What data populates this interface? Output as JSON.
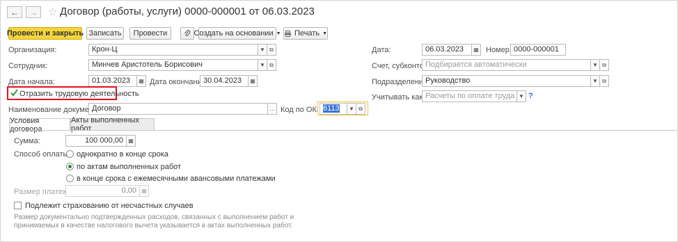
{
  "header": {
    "title": "Договор (работы, услуги) 0000-000001 от 06.03.2023"
  },
  "toolbar": {
    "post_close": "Провести и закрыть",
    "save": "Записать",
    "post": "Провести",
    "create_based": "Создать на основании",
    "print": "Печать"
  },
  "form": {
    "org_label": "Организация:",
    "org_value": "Крон-Ц",
    "employee_label": "Сотрудник:",
    "employee_value": "Минчев Аристотель Борисович",
    "start_label": "Дата начала:",
    "start_value": "01.03.2023",
    "end_label": "Дата окончания:",
    "end_value": "30.04.2023",
    "labor_checkbox_label": "Отразить трудовую деятельность",
    "labor_checked": true,
    "docname_label": "Наименование документа:",
    "docname_value": "Договор",
    "okz_label": "Код по ОКЗ:",
    "okz_value": "6113",
    "date_label": "Дата:",
    "date_value": "06.03.2023",
    "number_label": "Номер:",
    "number_value": "0000-000001",
    "account_label": "Счет, субконто:",
    "account_placeholder": "Подбирается автоматически",
    "department_label": "Подразделение:",
    "department_value": "Руководство",
    "account_as_label": "Учитывать как:",
    "account_as_placeholder": "Расчеты по оплате труда",
    "help": "?"
  },
  "tabs": [
    {
      "label": "Условия договора"
    },
    {
      "label": "Акты выполненных работ"
    }
  ],
  "terms": {
    "sum_label": "Сумма:",
    "sum_value": "100 000,00",
    "payment_label": "Способ оплаты:",
    "payment_options": [
      {
        "label": "однократно в конце срока",
        "selected": false
      },
      {
        "label": "по актам выполненных работ",
        "selected": true
      },
      {
        "label": "в конце срока с ежемесячными авансовыми платежами",
        "selected": false
      }
    ],
    "payment_size_label": "Размер платежа:",
    "payment_size_value": "0,00",
    "insurance_label": "Подлежит страхованию от несчастных случаев",
    "insurance_checked": false,
    "note": "Размер документально подтвержденных расходов, связанных с выполнением работ и принимаемых в качестве налогового вычета указывается в актах выполненных работ."
  },
  "colors": {
    "primary_button": "#f5d53b",
    "highlight_border": "#e3101a",
    "okz_focus": "#f0c63a",
    "selection": "#3b73d6"
  }
}
